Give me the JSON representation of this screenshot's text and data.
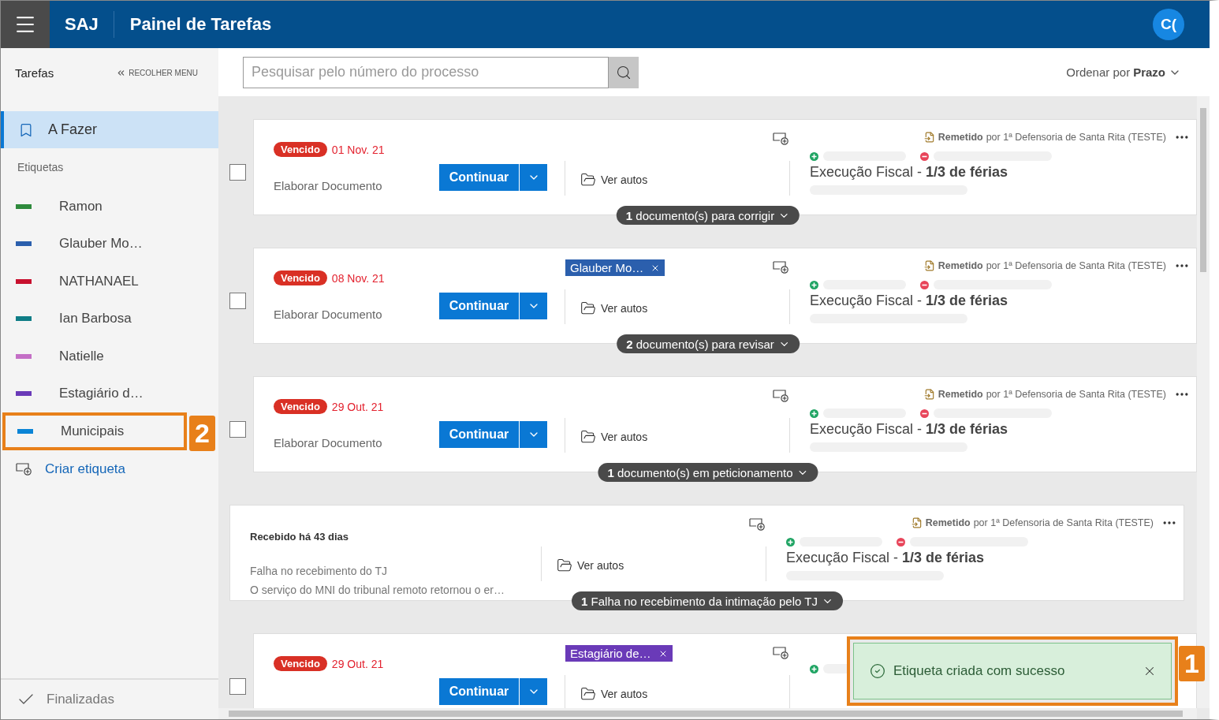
{
  "header": {
    "app_name": "SAJ",
    "title": "Painel de Tarefas",
    "avatar": "C("
  },
  "sidebar": {
    "heading": "Tarefas",
    "collapse": "RECOLHER MENU",
    "nav": [
      {
        "label": "A Fazer",
        "selected": true
      }
    ],
    "labels_heading": "Etiquetas",
    "labels": [
      {
        "name": "Ramon",
        "color": "#2e8a3c"
      },
      {
        "name": "Glauber Mo…",
        "color": "#2b5fad"
      },
      {
        "name": "NATHANAEL",
        "color": "#c8102e"
      },
      {
        "name": "Ian Barbosa",
        "color": "#0f7d86"
      },
      {
        "name": "Natielle",
        "color": "#c46fc6"
      },
      {
        "name": "Estagiário d…",
        "color": "#6a3ab8"
      },
      {
        "name": "Municipais",
        "color": "#0a84d6",
        "callout": "2"
      }
    ],
    "create_label": "Criar etiqueta",
    "footer": {
      "label": "Finalizadas"
    }
  },
  "search": {
    "placeholder": "Pesquisar pelo número do processo"
  },
  "sort": {
    "label": "Ordenar por",
    "value": "Prazo"
  },
  "tasks": [
    {
      "kind": "task",
      "checked": false,
      "status": "Vencido",
      "date": "01 Nov. 21",
      "description": "Elaborar Documento",
      "action": "Continuar",
      "view": "Ver autos",
      "sent_status": "Remetido",
      "sent_by": "por 1ª Defensoria de Santa Rita (TESTE)",
      "subject": "Execução Fiscal - **1/3 de férias**",
      "pill": "**1** documento(s) para corrigir"
    },
    {
      "kind": "task",
      "checked": false,
      "status": "Vencido",
      "date": "08 Nov. 21",
      "description": "Elaborar Documento",
      "action": "Continuar",
      "tag": {
        "label": "Glauber Mo…",
        "color": "#2b5fad"
      },
      "view": "Ver autos",
      "sent_status": "Remetido",
      "sent_by": "por 1ª Defensoria de Santa Rita (TESTE)",
      "subject": "Execução Fiscal - **1/3 de férias**",
      "pill": "**2** documento(s) para revisar"
    },
    {
      "kind": "task",
      "checked": false,
      "status": "Vencido",
      "date": "29 Out. 21",
      "description": "Elaborar Documento",
      "action": "Continuar",
      "view": "Ver autos",
      "sent_status": "Remetido",
      "sent_by": "por 1ª Defensoria de Santa Rita (TESTE)",
      "subject": "Execução Fiscal - **1/3 de férias**",
      "pill": "**1** documento(s) em peticionamento"
    },
    {
      "kind": "received",
      "received": "Recebido há 43 dias",
      "lines": [
        "Falha no recebimento do TJ",
        "O serviço do MNI do tribunal remoto retornou o er…"
      ],
      "view": "Ver autos",
      "sent_status": "Remetido",
      "sent_by": "por 1ª Defensoria de Santa Rita (TESTE)",
      "subject": "Execução Fiscal - **1/3 de férias**",
      "pill": "**1** Falha no recebimento da intimação pelo TJ"
    },
    {
      "kind": "task",
      "checked": false,
      "status": "Vencido",
      "date": "29 Out. 21",
      "action": "Continuar",
      "tag": {
        "label": "Estagiário de…",
        "color": "#6a3ab8"
      },
      "view": "Ver autos"
    }
  ],
  "toast": {
    "message": "Etiqueta criada com sucesso",
    "callout": "1"
  }
}
